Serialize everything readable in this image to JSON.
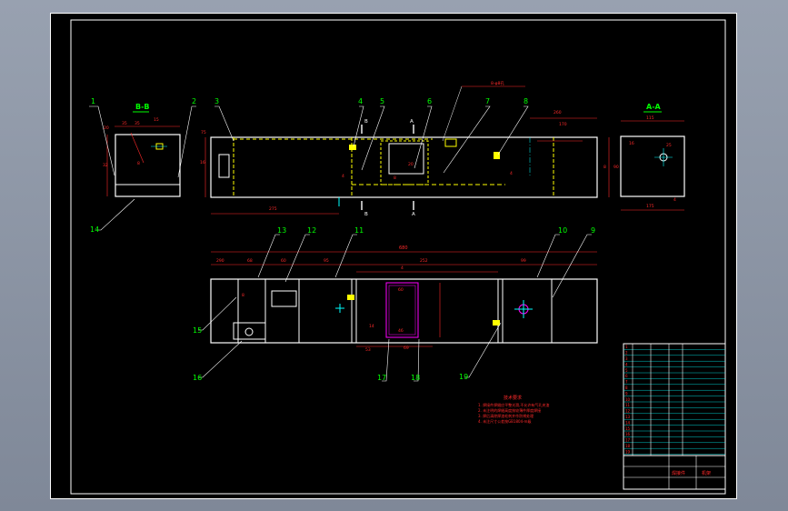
{
  "viewport": {
    "background": "#8a93a3",
    "sheet_color": "#000000"
  },
  "colors": {
    "line": "#ffffff",
    "dim": "#ff2a2a",
    "leader": "#ffffff",
    "hidden": "#ffff00",
    "center": "#00ffff",
    "balloon": "#00ff00",
    "accent": "#ff00ff"
  },
  "sections": {
    "bb_title": "B-B",
    "aa_title": "A-A",
    "section_marks": [
      "B",
      "B",
      "A",
      "A"
    ]
  },
  "balloons": [
    "1",
    "2",
    "3",
    "4",
    "5",
    "6",
    "7",
    "8",
    "9",
    "10",
    "11",
    "12",
    "13",
    "14",
    "15",
    "16",
    "17",
    "18",
    "19"
  ],
  "dimensions": {
    "front": [
      "75",
      "16",
      "4",
      "275",
      "20",
      "8",
      "4",
      "260",
      "170",
      "8"
    ],
    "top_overall": "680",
    "top": [
      "290",
      "68",
      "60",
      "95",
      "252",
      "99",
      "4",
      "60",
      "14",
      "46",
      "53",
      "69",
      "8"
    ],
    "bb": [
      "20",
      "35",
      "35",
      "15",
      "32",
      "8"
    ],
    "aa": [
      "115",
      "25",
      "16",
      "90",
      "175",
      "4"
    ],
    "callout": "8-φ8孔"
  },
  "tech_notes": {
    "title": "技术要求",
    "lines": [
      "1. 焊接件焊缝应平整光滑,不允许有气孔夹渣",
      "2. 未注明的焊缝高度按较薄件厚度焊接",
      "3. 焊后清除焊渣毛刺并作防锈处理",
      "4. 未注尺寸公差按GB1804-m级"
    ]
  },
  "title_block": {
    "rows": [
      "1",
      "2",
      "3",
      "4",
      "5",
      "6",
      "7",
      "8",
      "9",
      "10",
      "11",
      "12",
      "13",
      "14",
      "15",
      "16",
      "17",
      "18",
      "19"
    ],
    "bottom_label": "焊接件",
    "company": "机架"
  }
}
